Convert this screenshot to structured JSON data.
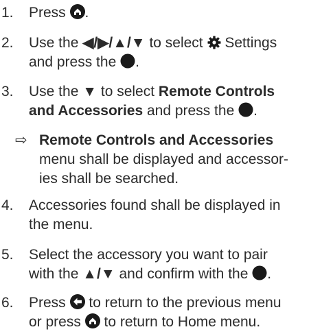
{
  "colors": {
    "text": "#2b2b2b",
    "icon": "#1a1a1a"
  },
  "steps": [
    {
      "number": "1.",
      "text_before": "Press",
      "icon": "home-icon",
      "text_after": "."
    },
    {
      "number": "2.",
      "line1_a": "Use the",
      "arrows": "◀/▶/▲/▼",
      "line1_b": "to select",
      "icon": "gear-icon",
      "line1_c": "Settings",
      "line2_a": "and press the",
      "ok_icon": "ok-button-icon",
      "line2_b": "."
    },
    {
      "number": "3.",
      "line1_a": "Use the",
      "arrows": "▼",
      "line1_b": "to select",
      "bold1": "Remote Controls",
      "bold2": "and Accessories",
      "line2_a": "and press the",
      "line2_b": "."
    },
    {
      "result_marker": "⇨",
      "bold": "Remote Controls and Accessories",
      "line2": "menu shall be displayed and accessor-",
      "line3": "ies shall be searched."
    },
    {
      "number": "4.",
      "line1": "Accessories found shall be displayed in",
      "line2": "the menu."
    },
    {
      "number": "5.",
      "line1": "Select the accessory you want to pair",
      "line2_a": "with the",
      "arrows": "▲/▼",
      "line2_b": "and confirm with the",
      "line2_c": "."
    },
    {
      "number": "6.",
      "line1_a": "Press",
      "back_icon": "back-icon",
      "line1_b": "to return to the previous menu",
      "line2_a": "or press",
      "home_icon": "home-icon",
      "line2_b": "to return to Home menu."
    }
  ]
}
